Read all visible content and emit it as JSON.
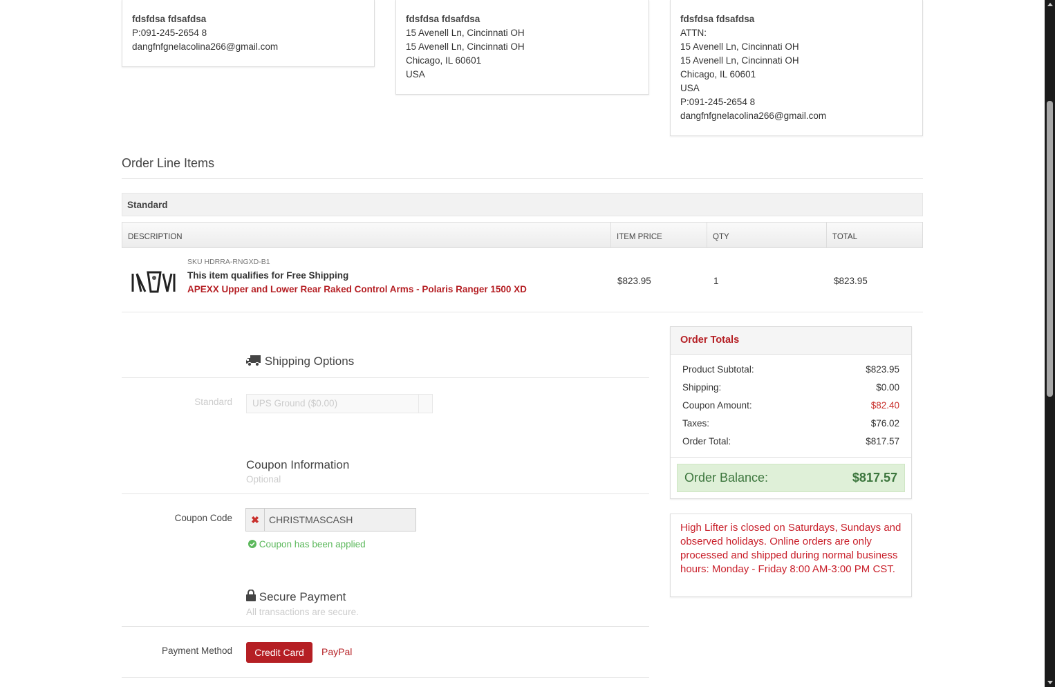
{
  "addresses": {
    "billing": {
      "name": "fdsfdsa fdsafdsa",
      "phone": "P:091-245-2654 8",
      "email": "dangfnfgnelacolina266@gmail.com"
    },
    "shipping": {
      "name": "fdsfdsa fdsafdsa",
      "line1": "15 Avenell Ln, Cincinnati OH",
      "line2": "15 Avenell Ln, Cincinnati OH",
      "city": "Chicago, IL 60601",
      "country": "USA"
    },
    "contact": {
      "name": "fdsfdsa fdsafdsa",
      "attn": "ATTN:",
      "line1": "15 Avenell Ln, Cincinnati OH",
      "line2": "15 Avenell Ln, Cincinnati OH",
      "city": "Chicago, IL 60601",
      "country": "USA",
      "phone": "P:091-245-2654 8",
      "email": "dangfnfgnelacolina266@gmail.com"
    }
  },
  "line_items": {
    "title": "Order Line Items",
    "group": "Standard",
    "columns": [
      "DESCRIPTION",
      "ITEM PRICE",
      "QTY",
      "TOTAL"
    ],
    "items": [
      {
        "sku": "SKU HDRRA-RNGXD-B1",
        "note": "This item qualifies for Free Shipping",
        "name": "APEXX Upper and Lower Rear Raked Control Arms - Polaris Ranger 1500 XD",
        "price": "$823.95",
        "qty": "1",
        "total": "$823.95",
        "image_icon": "control-arms-product-image"
      }
    ]
  },
  "shipping": {
    "title": "Shipping Options",
    "label": "Standard",
    "selected": "UPS Ground ($0.00)",
    "icon": "truck-icon"
  },
  "coupon": {
    "title": "Coupon Information",
    "subtitle": "Optional",
    "label": "Coupon Code",
    "value": "CHRISTMASCASH",
    "applied_text": "Coupon has been applied"
  },
  "payment": {
    "title": "Secure Payment",
    "subtitle": "All transactions are secure.",
    "label": "Payment Method",
    "options": [
      "Credit Card",
      "PayPal"
    ],
    "selected": "Credit Card",
    "icon": "lock-icon"
  },
  "totals": {
    "title": "Order Totals",
    "rows": [
      {
        "label": "Product Subtotal:",
        "value": "$823.95"
      },
      {
        "label": "Shipping:",
        "value": "$0.00"
      },
      {
        "label": "Coupon Amount:",
        "value": "$82.40"
      },
      {
        "label": "Taxes:",
        "value": "$76.02"
      },
      {
        "label": "Order Total:",
        "value": "$817.57"
      }
    ],
    "balance_label": "Order Balance:",
    "balance_value": "$817.57"
  },
  "notice": "High Lifter is closed on Saturdays, Sundays and observed holidays. Online orders are only processed and shipped during normal business hours: Monday - Friday 8:00 AM-3:00 PM CST.",
  "colors": {
    "accent": "#b51f24",
    "success": "#5cb85c",
    "balance_bg": "#dff0d8"
  }
}
